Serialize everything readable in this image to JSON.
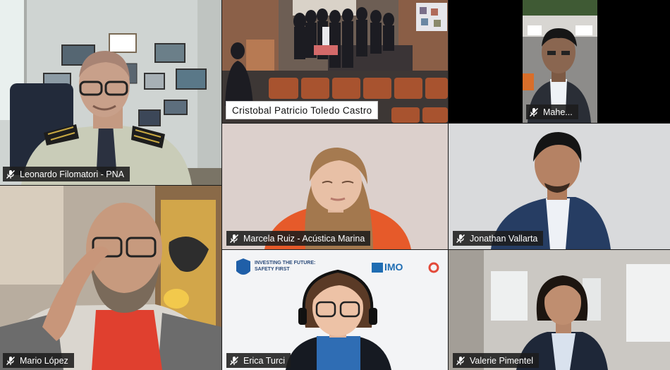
{
  "participants": [
    {
      "name": "Leonardo Filomatori - PNA",
      "muted": true
    },
    {
      "name": "Cristobal Patricio Toledo Castro",
      "muted": false
    },
    {
      "name": "Mahe...",
      "muted": true
    },
    {
      "name": "Marcela Ruiz - Acústica Marina",
      "muted": true
    },
    {
      "name": "Jonathan Vallarta",
      "muted": true
    },
    {
      "name": "Mario López",
      "muted": true
    },
    {
      "name": "Erica Turci",
      "muted": true
    },
    {
      "name": "Valerie Pimentel",
      "muted": true
    }
  ],
  "banner": {
    "left_text": "INVESTING THE FUTURE:",
    "left_sub": "SAFETY FIRST",
    "logo": "IMO"
  },
  "colors": {
    "tag_bg": "#1c1c1c",
    "imo_blue": "#1f6db3"
  }
}
